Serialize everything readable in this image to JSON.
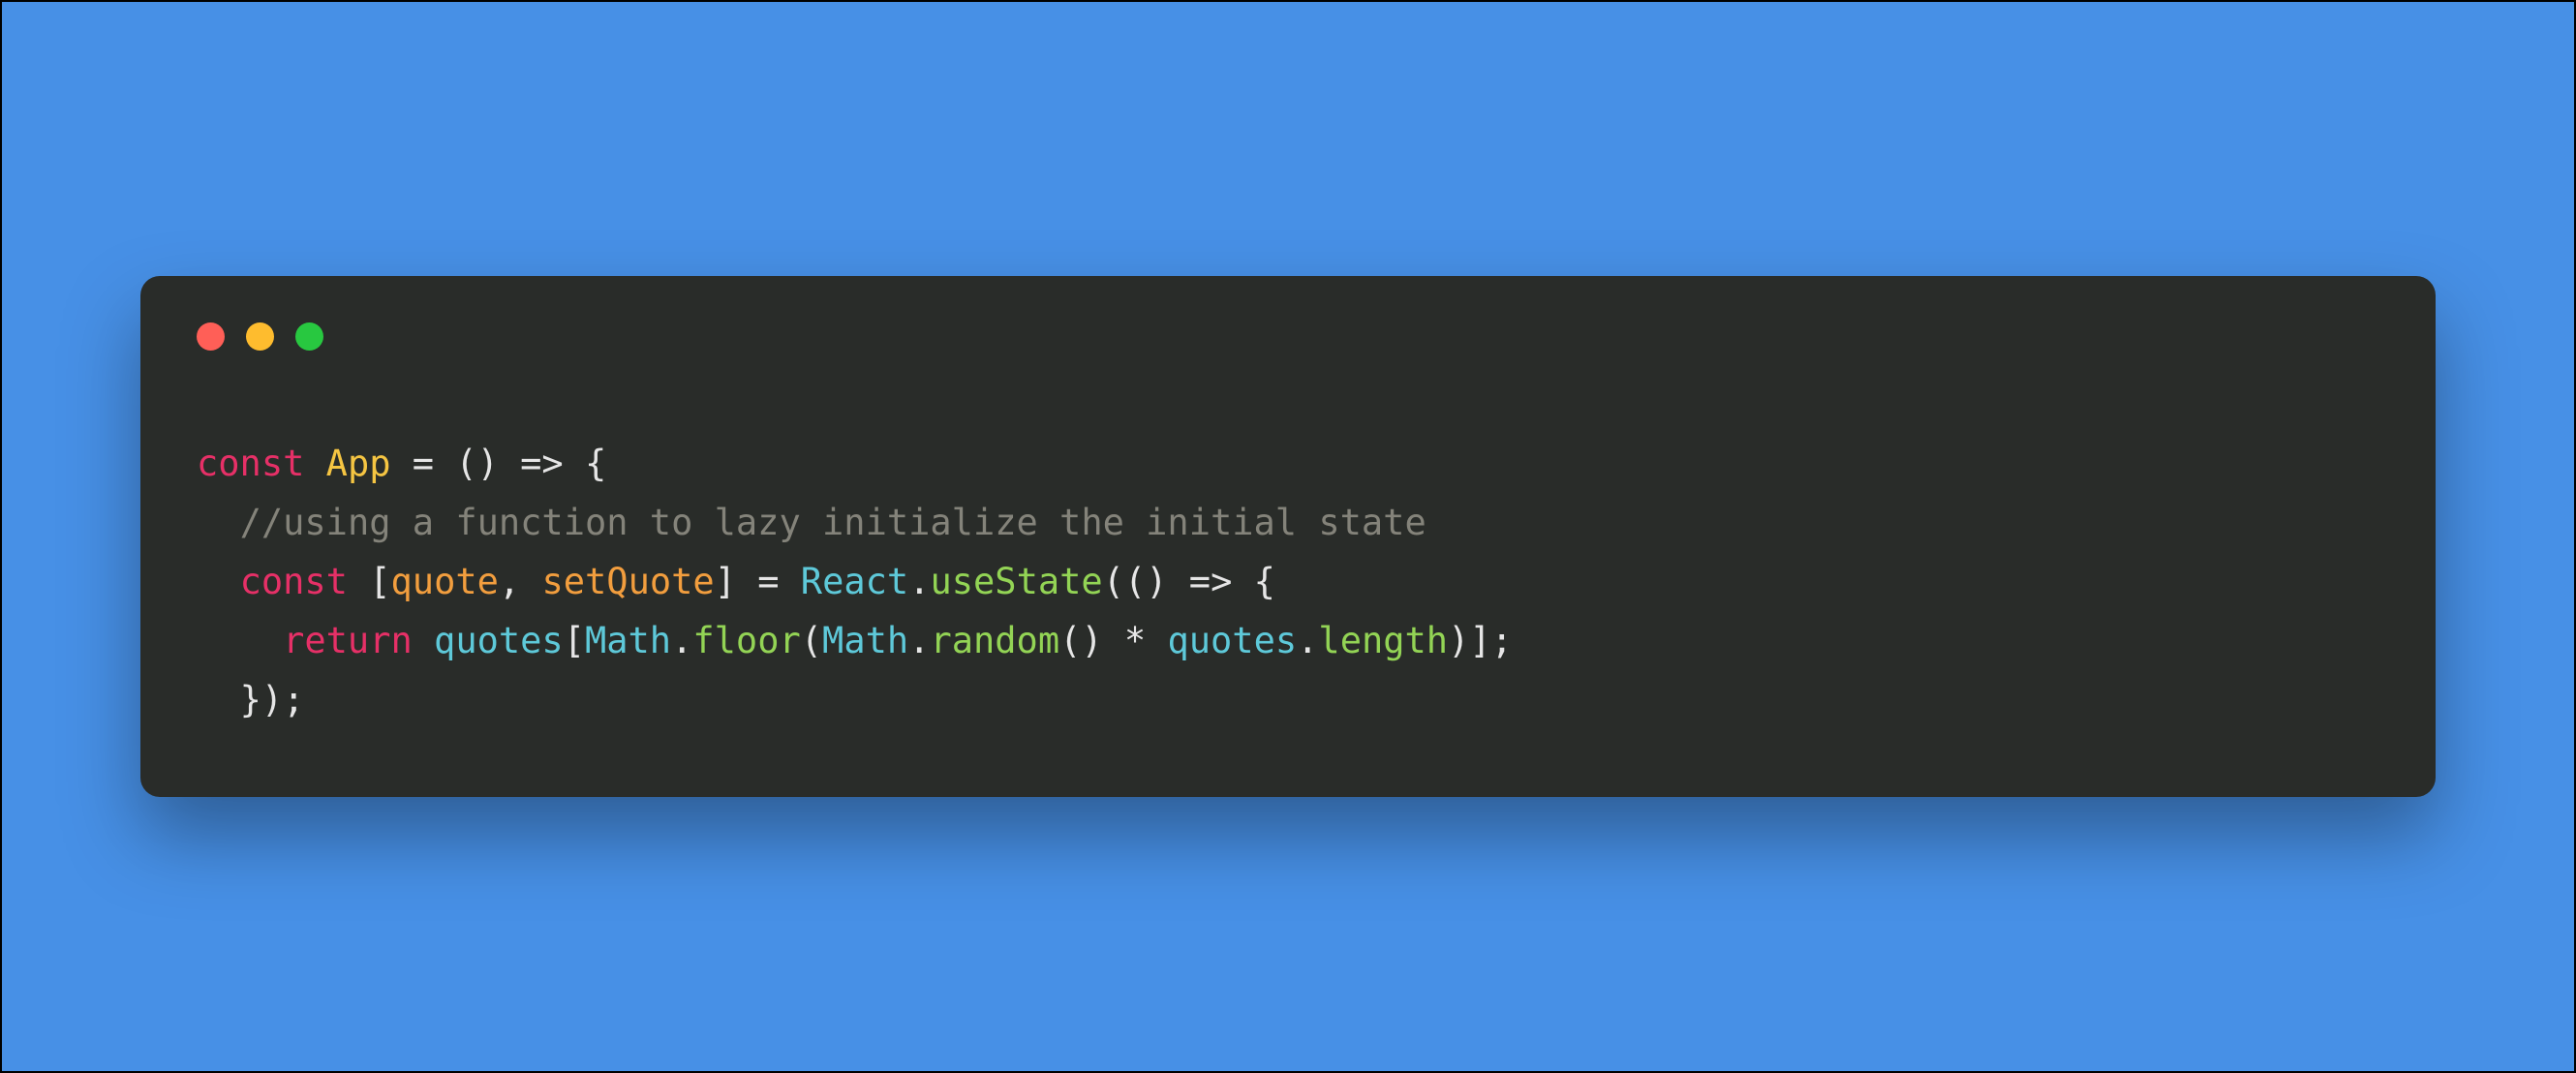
{
  "window": {
    "traffic_lights": {
      "red": "#ff5f57",
      "yellow": "#febc2e",
      "green": "#28c840"
    }
  },
  "code": {
    "tokens": {
      "kw_const1": "const",
      "sp": " ",
      "class_App": "App",
      "eq_arrow_open": " = () => {",
      "indent1": "  ",
      "comment1": "//using a function to lazy initialize the initial state",
      "kw_const2": "const",
      "punct_open_brkt": " [",
      "var_quote": "quote",
      "punct_comma": ", ",
      "var_setQuote": "setQuote",
      "punct_close_brkt_eq": "] = ",
      "obj_React": "React",
      "punct_dot1": ".",
      "method_useState": "useState",
      "punct_call_arrow": "(() => {",
      "indent2": "    ",
      "kw_return": "return",
      "obj_quotes1": "quotes",
      "punct_brkt_open2": "[",
      "obj_Math1": "Math",
      "punct_dot2": ".",
      "method_floor": "floor",
      "punct_paren_open": "(",
      "obj_Math2": "Math",
      "punct_dot3": ".",
      "method_random": "random",
      "punct_call_mul": "() * ",
      "obj_quotes2": "quotes",
      "punct_dot4": ".",
      "prop_length": "length",
      "punct_close_all": ")];",
      "punct_close_fn": "});"
    }
  }
}
